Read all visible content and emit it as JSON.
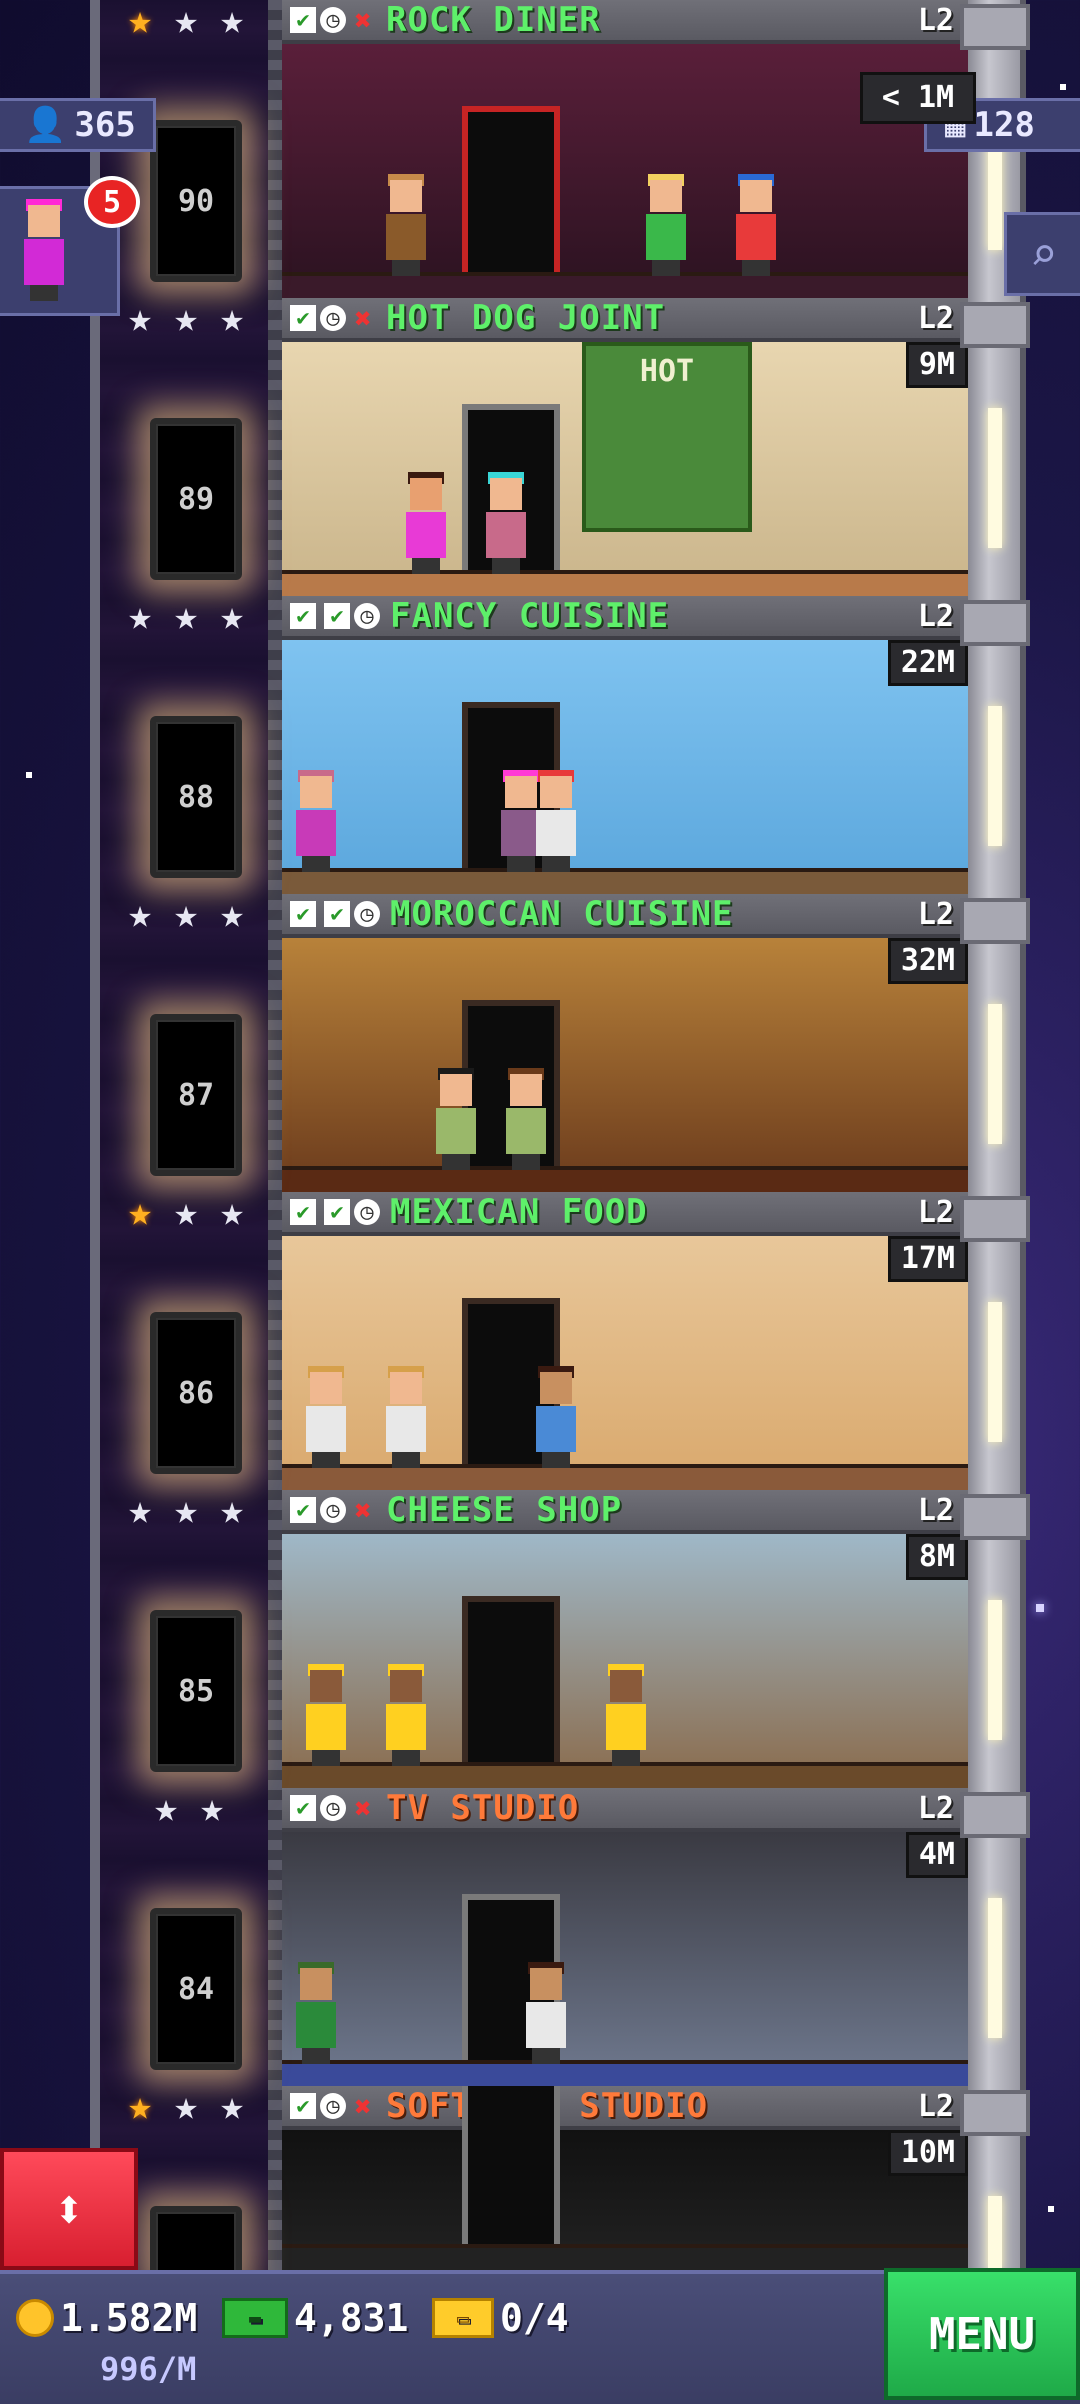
{
  "hud": {
    "population": "365",
    "floor_count": "128",
    "bitizen_notification": "5",
    "top_floor_cash_partial": "< 1M",
    "coins": "1.582M",
    "bux": "4,831",
    "tickets": "0/4",
    "income": "996/M",
    "menu_label": "MENU"
  },
  "floors": [
    {
      "number": "90",
      "name": "ROCK DINER",
      "level": "L2",
      "cash": "",
      "name_color": "green",
      "status": [
        "done",
        "clock",
        "x"
      ],
      "stars": [
        "gold",
        "white",
        "white"
      ]
    },
    {
      "number": "89",
      "name": "HOT DOG JOINT",
      "level": "L2",
      "cash": "9M",
      "name_color": "green",
      "status": [
        "done",
        "clock",
        "x"
      ],
      "stars": [
        "white",
        "white",
        "white"
      ],
      "sign": "HOT"
    },
    {
      "number": "88",
      "name": "FANCY CUISINE",
      "level": "L2",
      "cash": "22M",
      "name_color": "green",
      "status": [
        "done",
        "done",
        "clock"
      ],
      "stars": [
        "white",
        "white",
        "white"
      ]
    },
    {
      "number": "87",
      "name": "MOROCCAN CUISINE",
      "level": "L2",
      "cash": "32M",
      "name_color": "green",
      "status": [
        "done",
        "done",
        "clock"
      ],
      "stars": [
        "white",
        "white",
        "white"
      ]
    },
    {
      "number": "86",
      "name": "MEXICAN FOOD",
      "level": "L2",
      "cash": "17M",
      "name_color": "green",
      "status": [
        "done",
        "done",
        "clock"
      ],
      "stars": [
        "gold",
        "white",
        "white"
      ]
    },
    {
      "number": "85",
      "name": "CHEESE SHOP",
      "level": "L2",
      "cash": "8M",
      "name_color": "green",
      "status": [
        "done",
        "clock",
        "x"
      ],
      "stars": [
        "white",
        "white",
        "white"
      ]
    },
    {
      "number": "84",
      "name": "TV STUDIO",
      "level": "L2",
      "cash": "4M",
      "name_color": "orange",
      "status": [
        "done",
        "clock",
        "x"
      ],
      "stars": [
        "white",
        "white"
      ]
    },
    {
      "number": "",
      "name": "SOFTWARE STUDIO",
      "level": "L2",
      "cash": "10M",
      "name_color": "orange",
      "status": [
        "done",
        "clock",
        "x"
      ],
      "stars": [
        "gold",
        "white",
        "white"
      ]
    }
  ],
  "icons": {
    "population": "person-icon",
    "floors": "building-icon",
    "search": "magnifier-icon",
    "elevator": "up-down-arrows-icon",
    "coin": "coin-icon",
    "bux": "bux-icon",
    "ticket": "ticket-icon"
  }
}
